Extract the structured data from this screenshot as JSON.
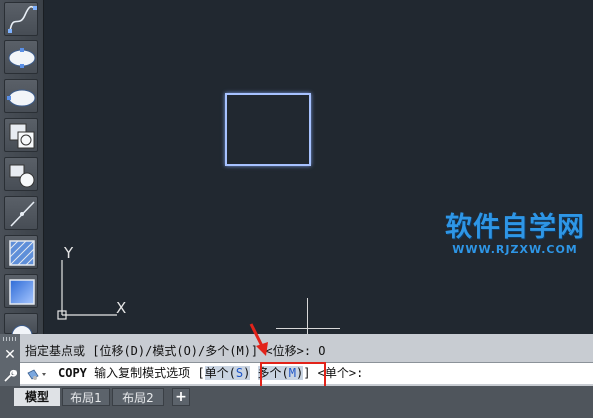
{
  "palette": {
    "tools": [
      {
        "icon": "spline-icon"
      },
      {
        "icon": "ellipse-icon"
      },
      {
        "icon": "ellipse-arc-icon"
      },
      {
        "icon": "insert-block-icon"
      },
      {
        "icon": "make-block-icon"
      },
      {
        "icon": "line-icon"
      },
      {
        "icon": "hatch-icon"
      },
      {
        "icon": "gradient-icon"
      },
      {
        "icon": "region-icon"
      }
    ]
  },
  "canvas": {
    "ucs": {
      "y_label": "Y",
      "x_label": "X"
    },
    "watermark": {
      "main": "软件自学网",
      "sub": "WWW.RJZXW.COM"
    }
  },
  "command": {
    "history": "指定基点或 [位移(D)/模式(O)/多个(M)] <位移>: O",
    "name": "COPY",
    "prompt": " 输入复制模式选项 [",
    "option1": "单个(",
    "option1_key": "S",
    "option1_close": ")",
    "option2": "多个(",
    "option2_key": "M",
    "option2_close": ")",
    "prompt_end": "] <单个>:"
  },
  "colors": {
    "highlight": "#e2231a",
    "option_key": "#1d55c9",
    "watermark": "#2e96e6",
    "rectangle": "#a7c2ff"
  },
  "tabs": {
    "items": [
      {
        "label": "模型"
      },
      {
        "label": "布局1"
      },
      {
        "label": "布局2"
      }
    ],
    "add_label": "+"
  }
}
